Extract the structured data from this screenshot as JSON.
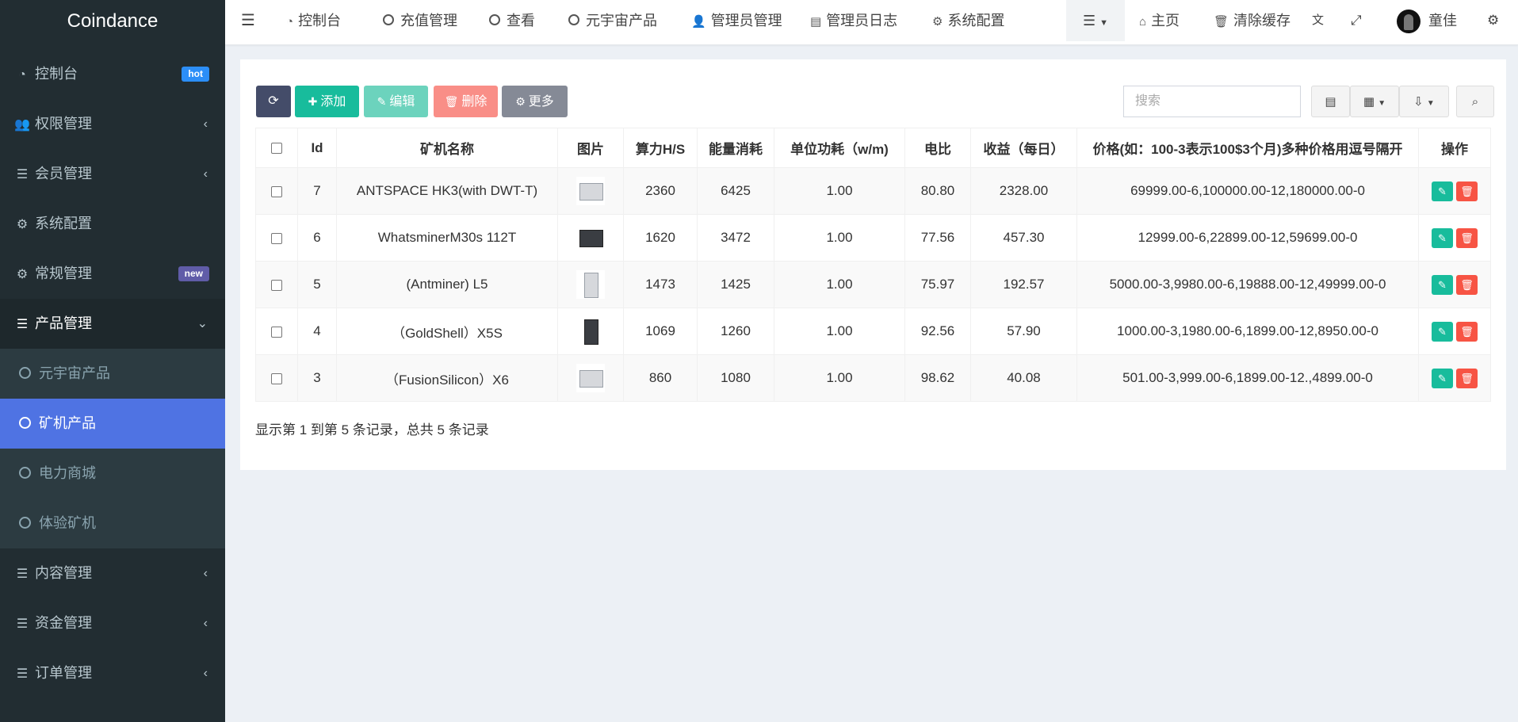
{
  "app": {
    "brand": "Coindance"
  },
  "sidebar": {
    "items": [
      {
        "label": "控制台",
        "icon": "dashboard-icon",
        "badge": "hot"
      },
      {
        "label": "权限管理",
        "icon": "users-icon",
        "chevron": "‹"
      },
      {
        "label": "会员管理",
        "icon": "list-icon",
        "chevron": "‹"
      },
      {
        "label": "系统配置",
        "icon": "gear-icon"
      },
      {
        "label": "常规管理",
        "icon": "gears-icon",
        "badge": "new"
      },
      {
        "label": "产品管理",
        "icon": "list-icon",
        "chevron": "⌄"
      },
      {
        "label": "内容管理",
        "icon": "list-icon",
        "chevron": "‹"
      },
      {
        "label": "资金管理",
        "icon": "list-icon",
        "chevron": "‹"
      },
      {
        "label": "订单管理",
        "icon": "list-icon",
        "chevron": "‹"
      }
    ],
    "submenu": [
      {
        "label": "元宇宙产品"
      },
      {
        "label": "矿机产品"
      },
      {
        "label": "电力商城"
      },
      {
        "label": "体验矿机"
      }
    ]
  },
  "topnav": {
    "items": [
      {
        "label": "控制台",
        "icon": "dashboard-icon"
      },
      {
        "label": "充值管理",
        "icon": "circle-icon"
      },
      {
        "label": "查看",
        "icon": "circle-icon"
      },
      {
        "label": "元宇宙产品",
        "icon": "circle-icon"
      },
      {
        "label": "管理员管理",
        "icon": "user-icon"
      },
      {
        "label": "管理员日志",
        "icon": "log-icon"
      },
      {
        "label": "系统配置",
        "icon": "gear-icon"
      }
    ],
    "right": {
      "home": "主页",
      "clear_cache": "清除缓存",
      "user_name": "童佳"
    }
  },
  "toolbar": {
    "add": "添加",
    "edit": "编辑",
    "delete": "删除",
    "more": "更多",
    "search_placeholder": "搜索"
  },
  "table": {
    "columns": [
      "Id",
      "矿机名称",
      "图片",
      "算力H/S",
      "能量消耗",
      "单位功耗（w/m)",
      "电比",
      "收益（每日）",
      "价格(如：100-3表示100$3个月)多种价格用逗号隔开",
      "操作"
    ],
    "rows": [
      {
        "id": "7",
        "name": "ANTSPACE HK3(with DWT-T)",
        "hash": "2360",
        "energy": "6425",
        "unit": "1.00",
        "ratio": "80.80",
        "income": "2328.00",
        "price": "69999.00-6,100000.00-12,180000.00-0"
      },
      {
        "id": "6",
        "name": "WhatsminerM30s 112T",
        "hash": "1620",
        "energy": "3472",
        "unit": "1.00",
        "ratio": "77.56",
        "income": "457.30",
        "price": "12999.00-6,22899.00-12,59699.00-0"
      },
      {
        "id": "5",
        "name": "(Antminer) L5",
        "hash": "1473",
        "energy": "1425",
        "unit": "1.00",
        "ratio": "75.97",
        "income": "192.57",
        "price": "5000.00-3,9980.00-6,19888.00-12,49999.00-0"
      },
      {
        "id": "4",
        "name": "（GoldShell）X5S",
        "hash": "1069",
        "energy": "1260",
        "unit": "1.00",
        "ratio": "92.56",
        "income": "57.90",
        "price": "1000.00-3,1980.00-6,1899.00-12,8950.00-0"
      },
      {
        "id": "3",
        "name": "（FusionSilicon）X6",
        "hash": "860",
        "energy": "1080",
        "unit": "1.00",
        "ratio": "98.62",
        "income": "40.08",
        "price": "501.00-3,999.00-6,1899.00-12.,4899.00-0"
      }
    ]
  },
  "footer": {
    "summary": "显示第 1 到第 5 条记录，总共 5 条记录"
  },
  "colors": {
    "sidebar_bg": "#222d32",
    "active_item": "#4f73e3",
    "btn_refresh": "#444c69",
    "btn_add": "#18bc9c",
    "btn_edit": "#6cd3bd",
    "btn_delete": "#f98e87",
    "btn_more": "#858a96"
  }
}
